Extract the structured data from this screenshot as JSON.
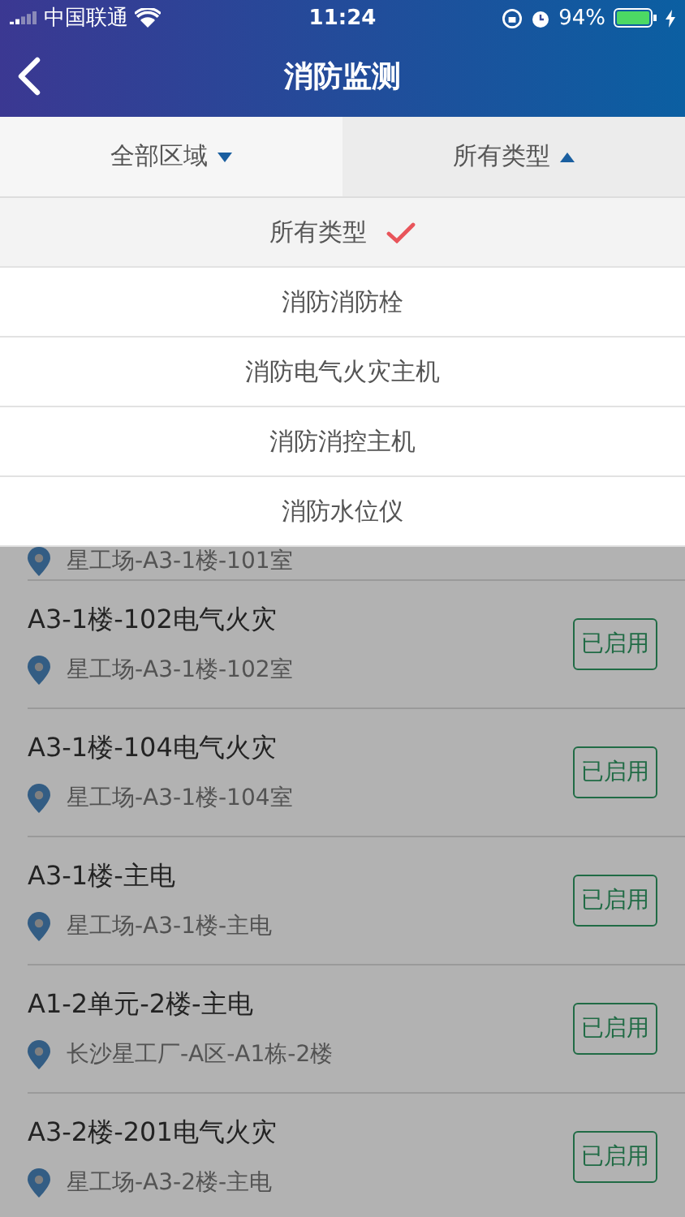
{
  "status_bar": {
    "carrier": "中国联通",
    "time": "11:24",
    "battery": "94%"
  },
  "nav": {
    "title": "消防监测"
  },
  "filters": [
    {
      "label": "全部区域",
      "expanded": false
    },
    {
      "label": "所有类型",
      "expanded": true
    }
  ],
  "menu": [
    {
      "label": "所有类型",
      "selected": true
    },
    {
      "label": "消防消防栓",
      "selected": false
    },
    {
      "label": "消防电气火灾主机",
      "selected": false
    },
    {
      "label": "消防消控主机",
      "selected": false
    },
    {
      "label": "消防水位仪",
      "selected": false
    }
  ],
  "devices": [
    {
      "location": "星工场-A3-1楼-101室"
    },
    {
      "title": "A3-1楼-102电气火灾",
      "location": "星工场-A3-1楼-102室",
      "status": "已启用"
    },
    {
      "title": "A3-1楼-104电气火灾",
      "location": "星工场-A3-1楼-104室",
      "status": "已启用"
    },
    {
      "title": "A3-1楼-主电",
      "location": "星工场-A3-1楼-主电",
      "status": "已启用"
    },
    {
      "title": "A1-2单元-2楼-主电",
      "location": "长沙星工厂-A区-A1栋-2楼",
      "status": "已启用"
    },
    {
      "title": "A3-2楼-201电气火灾",
      "location": "星工场-A3-2楼-主电",
      "status": "已启用"
    }
  ]
}
